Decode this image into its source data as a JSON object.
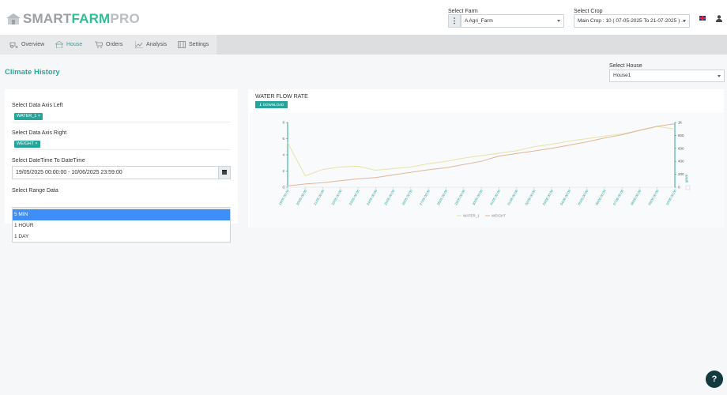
{
  "brand": {
    "smart": "SMART",
    "farm": "FARM",
    "pro": "PRO"
  },
  "header": {
    "farm_label": "Select Farm",
    "farm_value": "A Agri_Farm",
    "crop_label": "Select Crop",
    "crop_value": "Main Crop : 10 ( 07-05-2025 To 21-07-2025 ) ..."
  },
  "nav": [
    {
      "label": "Overview",
      "icon": "tractor-icon",
      "active": false
    },
    {
      "label": "House",
      "icon": "house-icon",
      "active": true
    },
    {
      "label": "Orders",
      "icon": "cart-icon",
      "active": false
    },
    {
      "label": "Analysis",
      "icon": "chart-icon",
      "active": false
    },
    {
      "label": "Settings",
      "icon": "settings-icon",
      "active": false
    }
  ],
  "page": {
    "title": "Climate History",
    "house_label": "Select House",
    "house_value": "House1"
  },
  "form": {
    "left_axis_label": "Select Data Axis Left",
    "left_axis_tag": "WATER_1 ×",
    "right_axis_label": "Select Data Axis Right",
    "right_axis_tag": "WEIGHT ×",
    "datetime_label": "Select DateTime To DateTime",
    "datetime_value": "19/05/2025 00:00:00 - 10/06/2025 23:59:00",
    "range_label": "Select Range Data",
    "range_options": [
      "5 MIN",
      "1 HOUR",
      "1 DAY"
    ],
    "range_selected": "5 MIN"
  },
  "chart_panel": {
    "title": "WATER FLOW RATE",
    "download_label": "DOWNLOAD"
  },
  "chart_data": {
    "type": "line",
    "x": [
      "19/05 00:00",
      "20/05 00:00",
      "21/05 00:00",
      "22/05 00:00",
      "23/05 00:00",
      "24/05 00:00",
      "25/05 00:00",
      "26/05 00:00",
      "27/05 00:00",
      "28/05 00:00",
      "29/05 00:00",
      "30/05 00:00",
      "31/05 00:00",
      "01/06 00:00",
      "02/06 00:00",
      "03/06 00:00",
      "04/06 00:00",
      "05/06 00:00",
      "06/06 00:00",
      "07/06 00:00",
      "08/06 00:00",
      "09/06 00:00",
      "10/06 00:00"
    ],
    "series": [
      {
        "name": "WATER_1",
        "axis": "left",
        "color": "#e9e2a6",
        "values": [
          5.5,
          1.4,
          2.2,
          2.5,
          2.6,
          2.1,
          2.3,
          2.5,
          2.9,
          3.2,
          3.6,
          3.9,
          4.2,
          4.5,
          5.0,
          5.3,
          5.7,
          6.0,
          6.3,
          6.6,
          7.0,
          7.5,
          7.2
        ]
      },
      {
        "name": "WEIGHT",
        "axis": "right",
        "color": "#e0b59a",
        "values": [
          20,
          50,
          70,
          100,
          130,
          150,
          190,
          230,
          270,
          300,
          350,
          400,
          480,
          520,
          560,
          600,
          650,
          700,
          760,
          810,
          880,
          940,
          980
        ]
      }
    ],
    "ylim_left": [
      0,
      8
    ],
    "ylim_right": [
      0,
      1000
    ],
    "yticks_left": [
      0,
      2,
      4,
      6,
      8
    ],
    "yticks_right": [
      0,
      200,
      400,
      600,
      800,
      "1k"
    ],
    "ylabel_right": "gram",
    "legend_position": "bottom",
    "axis_color": "#27a59a"
  },
  "help_label": "?"
}
